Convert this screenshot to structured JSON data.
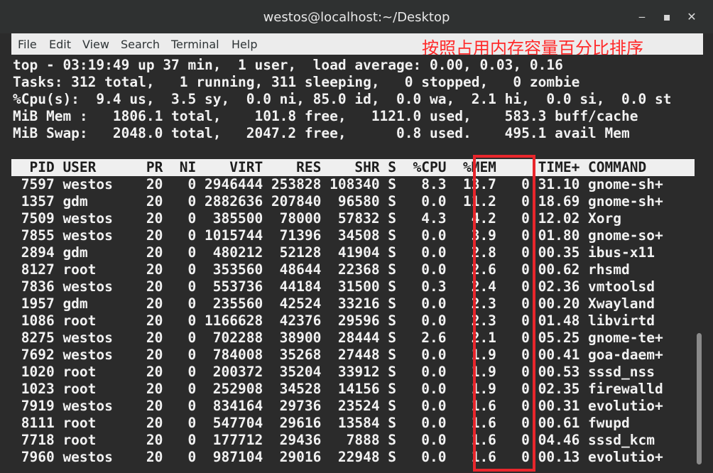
{
  "window": {
    "title": "westos@localhost:~/Desktop"
  },
  "window_buttons": {
    "minimize": "‒",
    "maximize": "▪",
    "close": "✕"
  },
  "menu": [
    "File",
    "Edit",
    "View",
    "Search",
    "Terminal",
    "Help"
  ],
  "annotation": "按照占用内存容量百分比排序",
  "colors": {
    "annotation": "#ff2a2a",
    "highlight_border": "#e8262c",
    "terminal_bg": "#2b2b2b",
    "terminal_fg": "#f2f2f2"
  },
  "summary": [
    "top - 03:19:49 up 37 min,  1 user,  load average: 0.00, 0.03, 0.16",
    "Tasks: 312 total,   1 running, 311 sleeping,   0 stopped,   0 zombie",
    "%Cpu(s):  9.4 us,  3.5 sy,  0.0 ni, 85.0 id,  0.0 wa,  2.1 hi,  0.0 si,  0.0 st",
    "MiB Mem :   1806.1 total,    101.8 free,   1121.0 used,    583.3 buff/cache",
    "MiB Swap:   2048.0 total,   2047.2 free,      0.8 used.    495.1 avail Mem"
  ],
  "header": "  PID USER      PR  NI    VIRT    RES    SHR S  %CPU  %MEM     TIME+ COMMAND",
  "rows": [
    " 7597 westos    20   0 2946444 253828 108340 S   8.3  13.7   0:31.10 gnome-sh+",
    " 1357 gdm       20   0 2882636 207840  96580 S   0.0  11.2   0:18.69 gnome-sh+",
    " 7509 westos    20   0  385500  78000  57832 S   4.3   4.2   0:12.02 Xorg",
    " 7855 westos    20   0 1015744  71396  34508 S   0.0   3.9   0:01.80 gnome-so+",
    " 2894 gdm       20   0  480212  52128  41904 S   0.0   2.8   0:00.35 ibus-x11",
    " 8127 root      20   0  353560  48644  22368 S   0.0   2.6   0:00.62 rhsmd",
    " 7836 westos    20   0  553736  44184  31500 S   0.3   2.4   0:02.36 vmtoolsd",
    " 1957 gdm       20   0  235560  42524  33216 S   0.0   2.3   0:00.20 Xwayland",
    " 1086 root      20   0 1166628  42376  29596 S   0.0   2.3   0:01.48 libvirtd",
    " 8275 westos    20   0  702288  38900  28444 S   2.6   2.1   0:05.25 gnome-te+",
    " 7692 westos    20   0  784008  35268  27448 S   0.0   1.9   0:00.41 goa-daem+",
    " 1020 root      20   0  200372  35204  33912 S   0.0   1.9   0:00.53 sssd_nss",
    " 1023 root      20   0  252908  34528  14156 S   0.0   1.9   0:02.35 firewalld",
    " 7919 westos    20   0  834164  29736  23524 S   0.0   1.6   0:00.31 evolutio+",
    " 8111 root      20   0  547704  29616  13584 S   0.0   1.6   0:00.61 fwupd",
    " 7718 root      20   0  177712  29436   7888 S   0.0   1.6   0:04.46 sssd_kcm",
    " 7960 westos    20   0  987104  29016  22948 S   0.0   1.6   0:00.13 evolutio+"
  ]
}
